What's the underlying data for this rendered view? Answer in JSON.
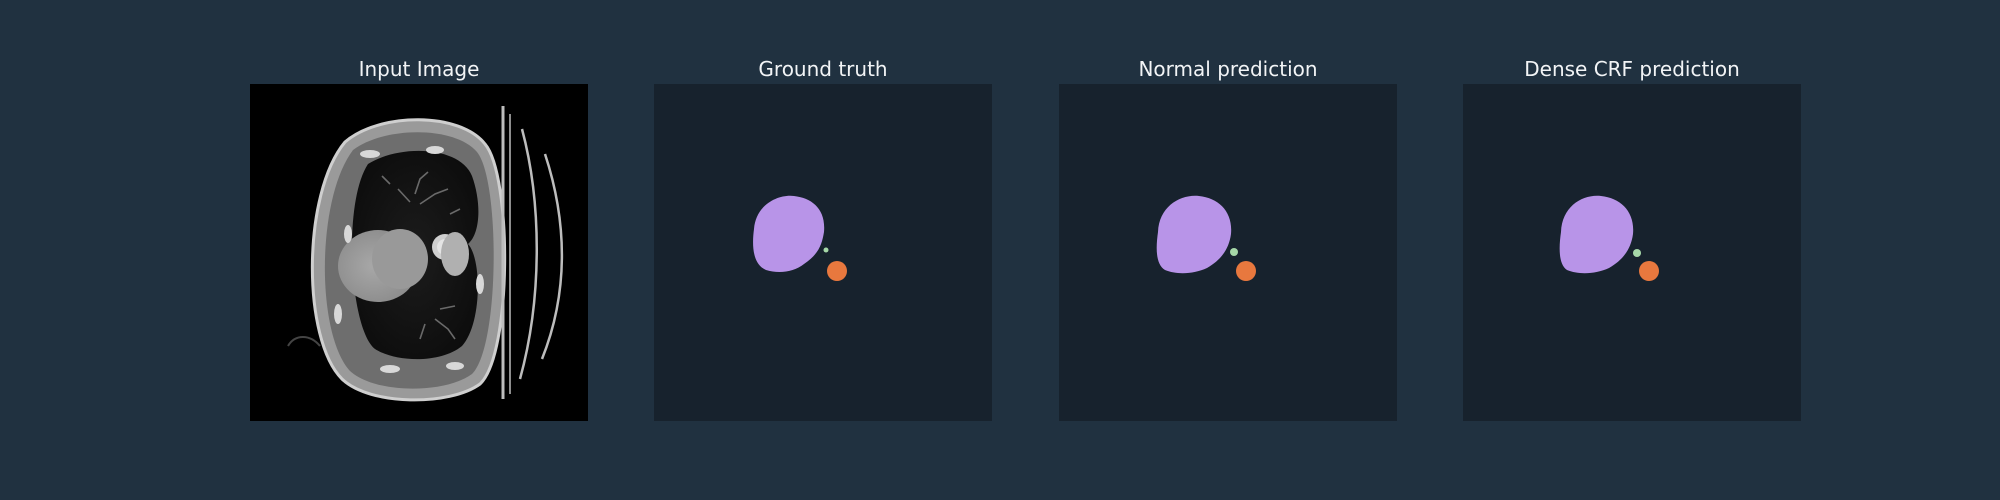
{
  "figure": {
    "panels": [
      {
        "title": "Input Image",
        "kind": "ct-scan"
      },
      {
        "title": "Ground truth",
        "kind": "segmentation-mask"
      },
      {
        "title": "Normal prediction",
        "kind": "segmentation-mask"
      },
      {
        "title": "Dense CRF prediction",
        "kind": "segmentation-mask"
      }
    ],
    "colors": {
      "background": "#203140",
      "mask_background": "#17222d",
      "heart_region": "#b894e8",
      "aorta_region": "#e8783e",
      "small_region": "#a6d8a8",
      "title_text": "#f2f4f6"
    }
  }
}
